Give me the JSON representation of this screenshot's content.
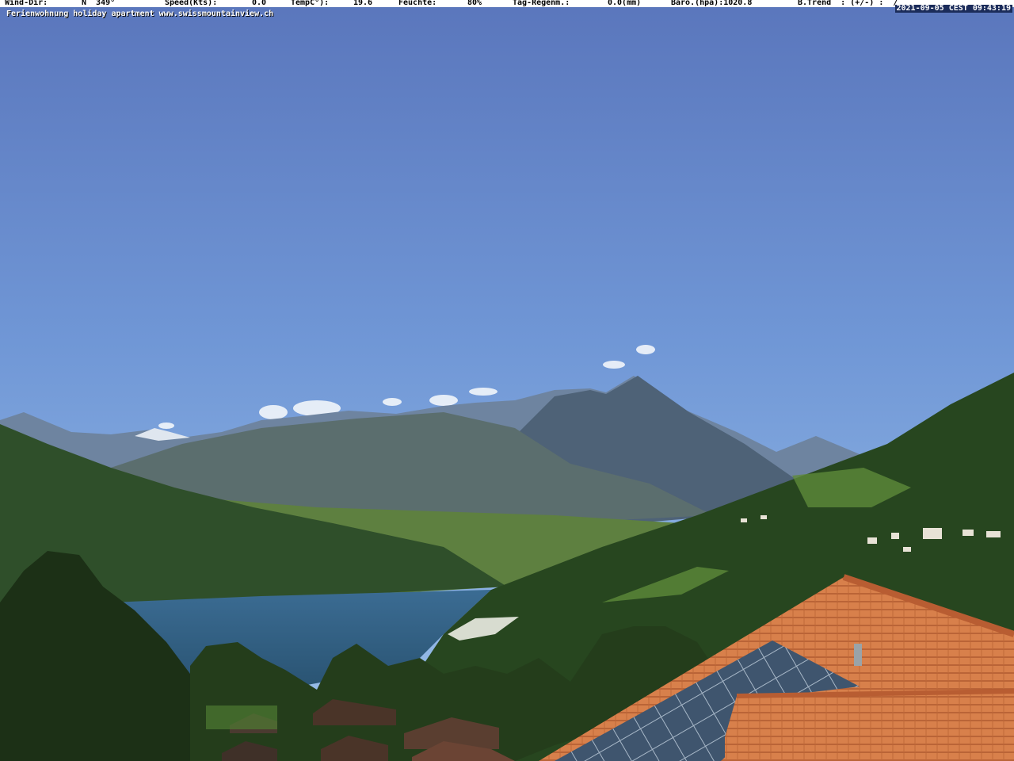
{
  "weather_bar": {
    "wind_dir_label": "Wind-Dir:",
    "wind_dir_value": "N  349°",
    "speed_label": "Speed(Kts):",
    "speed_value": "0.0",
    "temp_label": "TempC°):",
    "temp_value": "19.6",
    "humidity_label": "Feuchte:",
    "humidity_value": "80%",
    "rain_label": "Tag-Regenm.:",
    "rain_value": "0.0(mm)",
    "baro_label": "Baro.(hpa):1020.8",
    "trend_label": "B.Trend  : (+/-) :  /"
  },
  "caption": "Ferienwohnung holiday apartment www.swissmountainview.ch",
  "timestamp": "2021-09-05 CEST 09:43:19",
  "colors": {
    "sky_top": "#5a77bd",
    "sky_bottom": "#8fb7e6",
    "lake": "#2f5f85",
    "forest": "#23401e",
    "roof": "#d77a45"
  }
}
